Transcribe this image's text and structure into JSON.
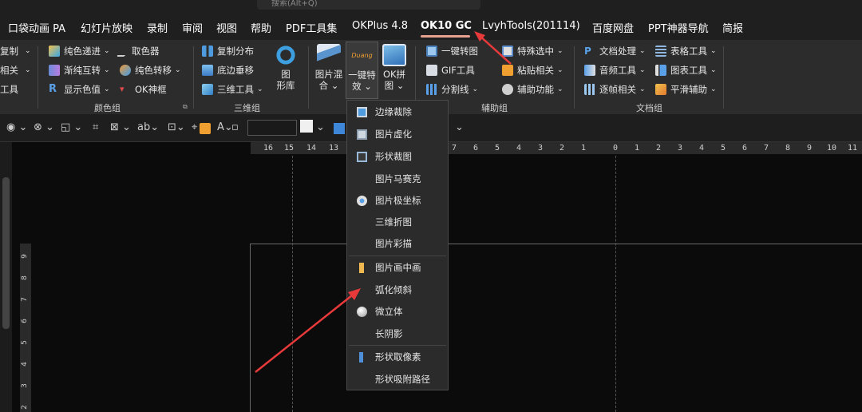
{
  "search": {
    "text": "搜索(Alt+Q)"
  },
  "tabs": [
    {
      "label": "口袋动画 PA"
    },
    {
      "label": "幻灯片放映"
    },
    {
      "label": "录制"
    },
    {
      "label": "审阅"
    },
    {
      "label": "视图"
    },
    {
      "label": "帮助"
    },
    {
      "label": "PDF工具集"
    },
    {
      "label": "OKPlus 4.8"
    },
    {
      "label": "OK10 GC"
    },
    {
      "label": "LvyhTools(201114)"
    },
    {
      "label": "百度网盘"
    },
    {
      "label": "PPT神器导航"
    },
    {
      "label": "简报"
    }
  ],
  "ribbon": {
    "left_cut": [
      "复制",
      "相关",
      "工具"
    ],
    "color_group": {
      "items": [
        "纯色递进",
        "取色器",
        "渐纯互转",
        "纯色转移",
        "显示色值",
        "OK神框"
      ],
      "label": "颜色组"
    },
    "three_d_group": {
      "items": [
        "复制分布",
        "底边垂移",
        "三维工具"
      ],
      "big_label_1": "图",
      "big_label_2": "形库",
      "label": "三维组"
    },
    "effects": {
      "mix_1": "图片混",
      "mix_2": "合",
      "effect_1": "一键特",
      "effect_2": "效",
      "effect_icon_text": "Duang",
      "puzzle_1": "OK拼",
      "puzzle_2": "图"
    },
    "aux_group": {
      "items": [
        "一键转图",
        "特殊选中",
        "GIF工具",
        "粘贴相关",
        "分割线",
        "辅助功能"
      ],
      "label": "辅助组"
    },
    "doc_group": {
      "items": [
        "文档处理",
        "表格工具",
        "音频工具",
        "图表工具",
        "逐帧相关",
        "平滑辅助"
      ],
      "label": "文档组"
    }
  },
  "ruler": {
    "h_left": [
      "16",
      "15",
      "14",
      "13"
    ],
    "h_right": [
      "7",
      "6",
      "5",
      "4",
      "3",
      "2",
      "1",
      "0",
      "1",
      "2",
      "3",
      "4",
      "5",
      "6",
      "7",
      "8",
      "9",
      "10",
      "11"
    ],
    "v": [
      "9",
      "8",
      "7",
      "6",
      "5",
      "4",
      "3",
      "2"
    ]
  },
  "menu": {
    "items": [
      {
        "label": "边缘裁除",
        "icon": "crop-edge-icon"
      },
      {
        "label": "图片虚化",
        "icon": "blur-icon"
      },
      {
        "label": "形状裁图",
        "icon": "shape-crop-icon"
      },
      {
        "label": "图片马赛克",
        "icon": ""
      },
      {
        "label": "图片极坐标",
        "icon": "polar-icon"
      },
      {
        "label": "三维折图",
        "icon": ""
      },
      {
        "label": "图片彩描",
        "icon": ""
      },
      {
        "label": "图片画中画",
        "icon": "pip-icon"
      },
      {
        "label": "弧化倾斜",
        "icon": ""
      },
      {
        "label": "微立体",
        "icon": "sphere-icon"
      },
      {
        "label": "长阴影",
        "icon": ""
      },
      {
        "label": "形状取像素",
        "icon": "pixel-icon"
      },
      {
        "label": "形状吸附路径",
        "icon": ""
      }
    ]
  },
  "colors": {
    "accent_arrow": "#e83a3a",
    "tab_underline": "#e8a090"
  }
}
